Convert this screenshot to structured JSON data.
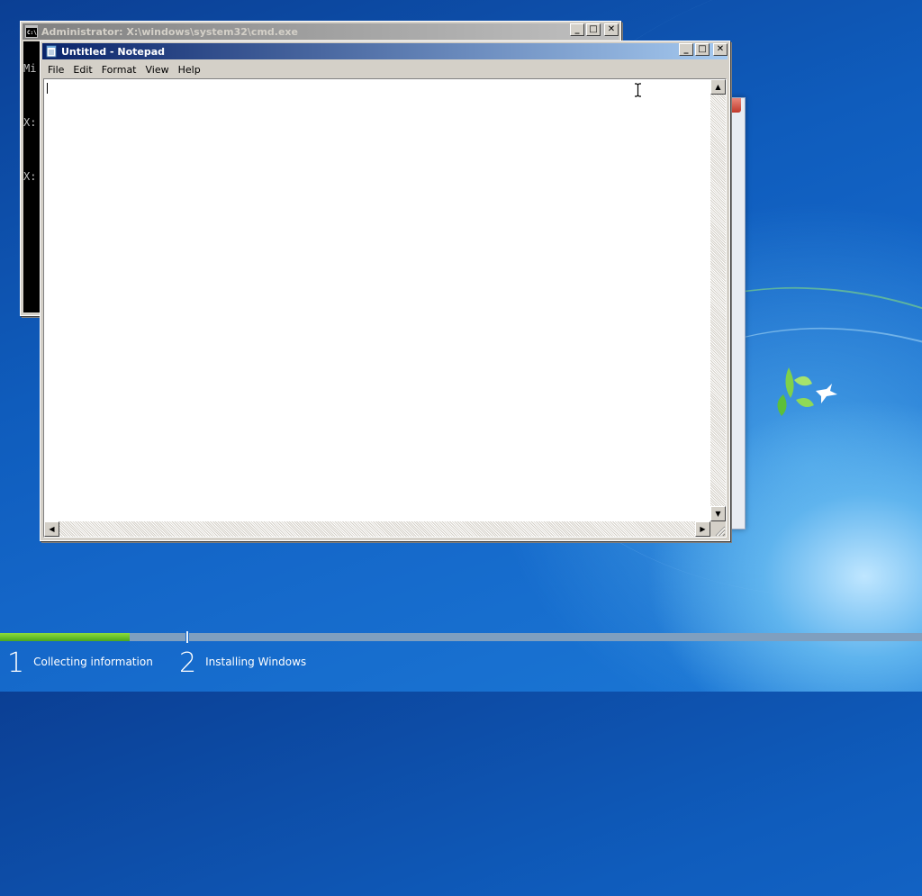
{
  "desktop": {
    "background_colors": {
      "top": "#0b3f94",
      "bottom": "#1b78d6",
      "glow": "#bfe6ff"
    }
  },
  "cmd_window": {
    "title": "Administrator: X:\\windows\\system32\\cmd.exe",
    "icon": "console-icon",
    "console_lines": [
      "Mi",
      "",
      "X:",
      "",
      "X:"
    ],
    "buttons": {
      "minimize": "minimize-icon",
      "maximize": "maximize-icon",
      "close": "close-icon"
    }
  },
  "notepad": {
    "title": "Untitled - Notepad",
    "icon": "notepad-icon",
    "menu": [
      "File",
      "Edit",
      "Format",
      "View",
      "Help"
    ],
    "text": "",
    "buttons": {
      "minimize": "minimize-icon",
      "maximize": "maximize-icon",
      "close": "close-icon"
    }
  },
  "setup_progress": {
    "steps": [
      {
        "number": "1",
        "label": "Collecting information"
      },
      {
        "number": "2",
        "label": "Installing Windows"
      }
    ],
    "progress_fraction": 0.7,
    "colors": {
      "fill": "#6cc52c",
      "track": "#7f9fbf"
    }
  }
}
